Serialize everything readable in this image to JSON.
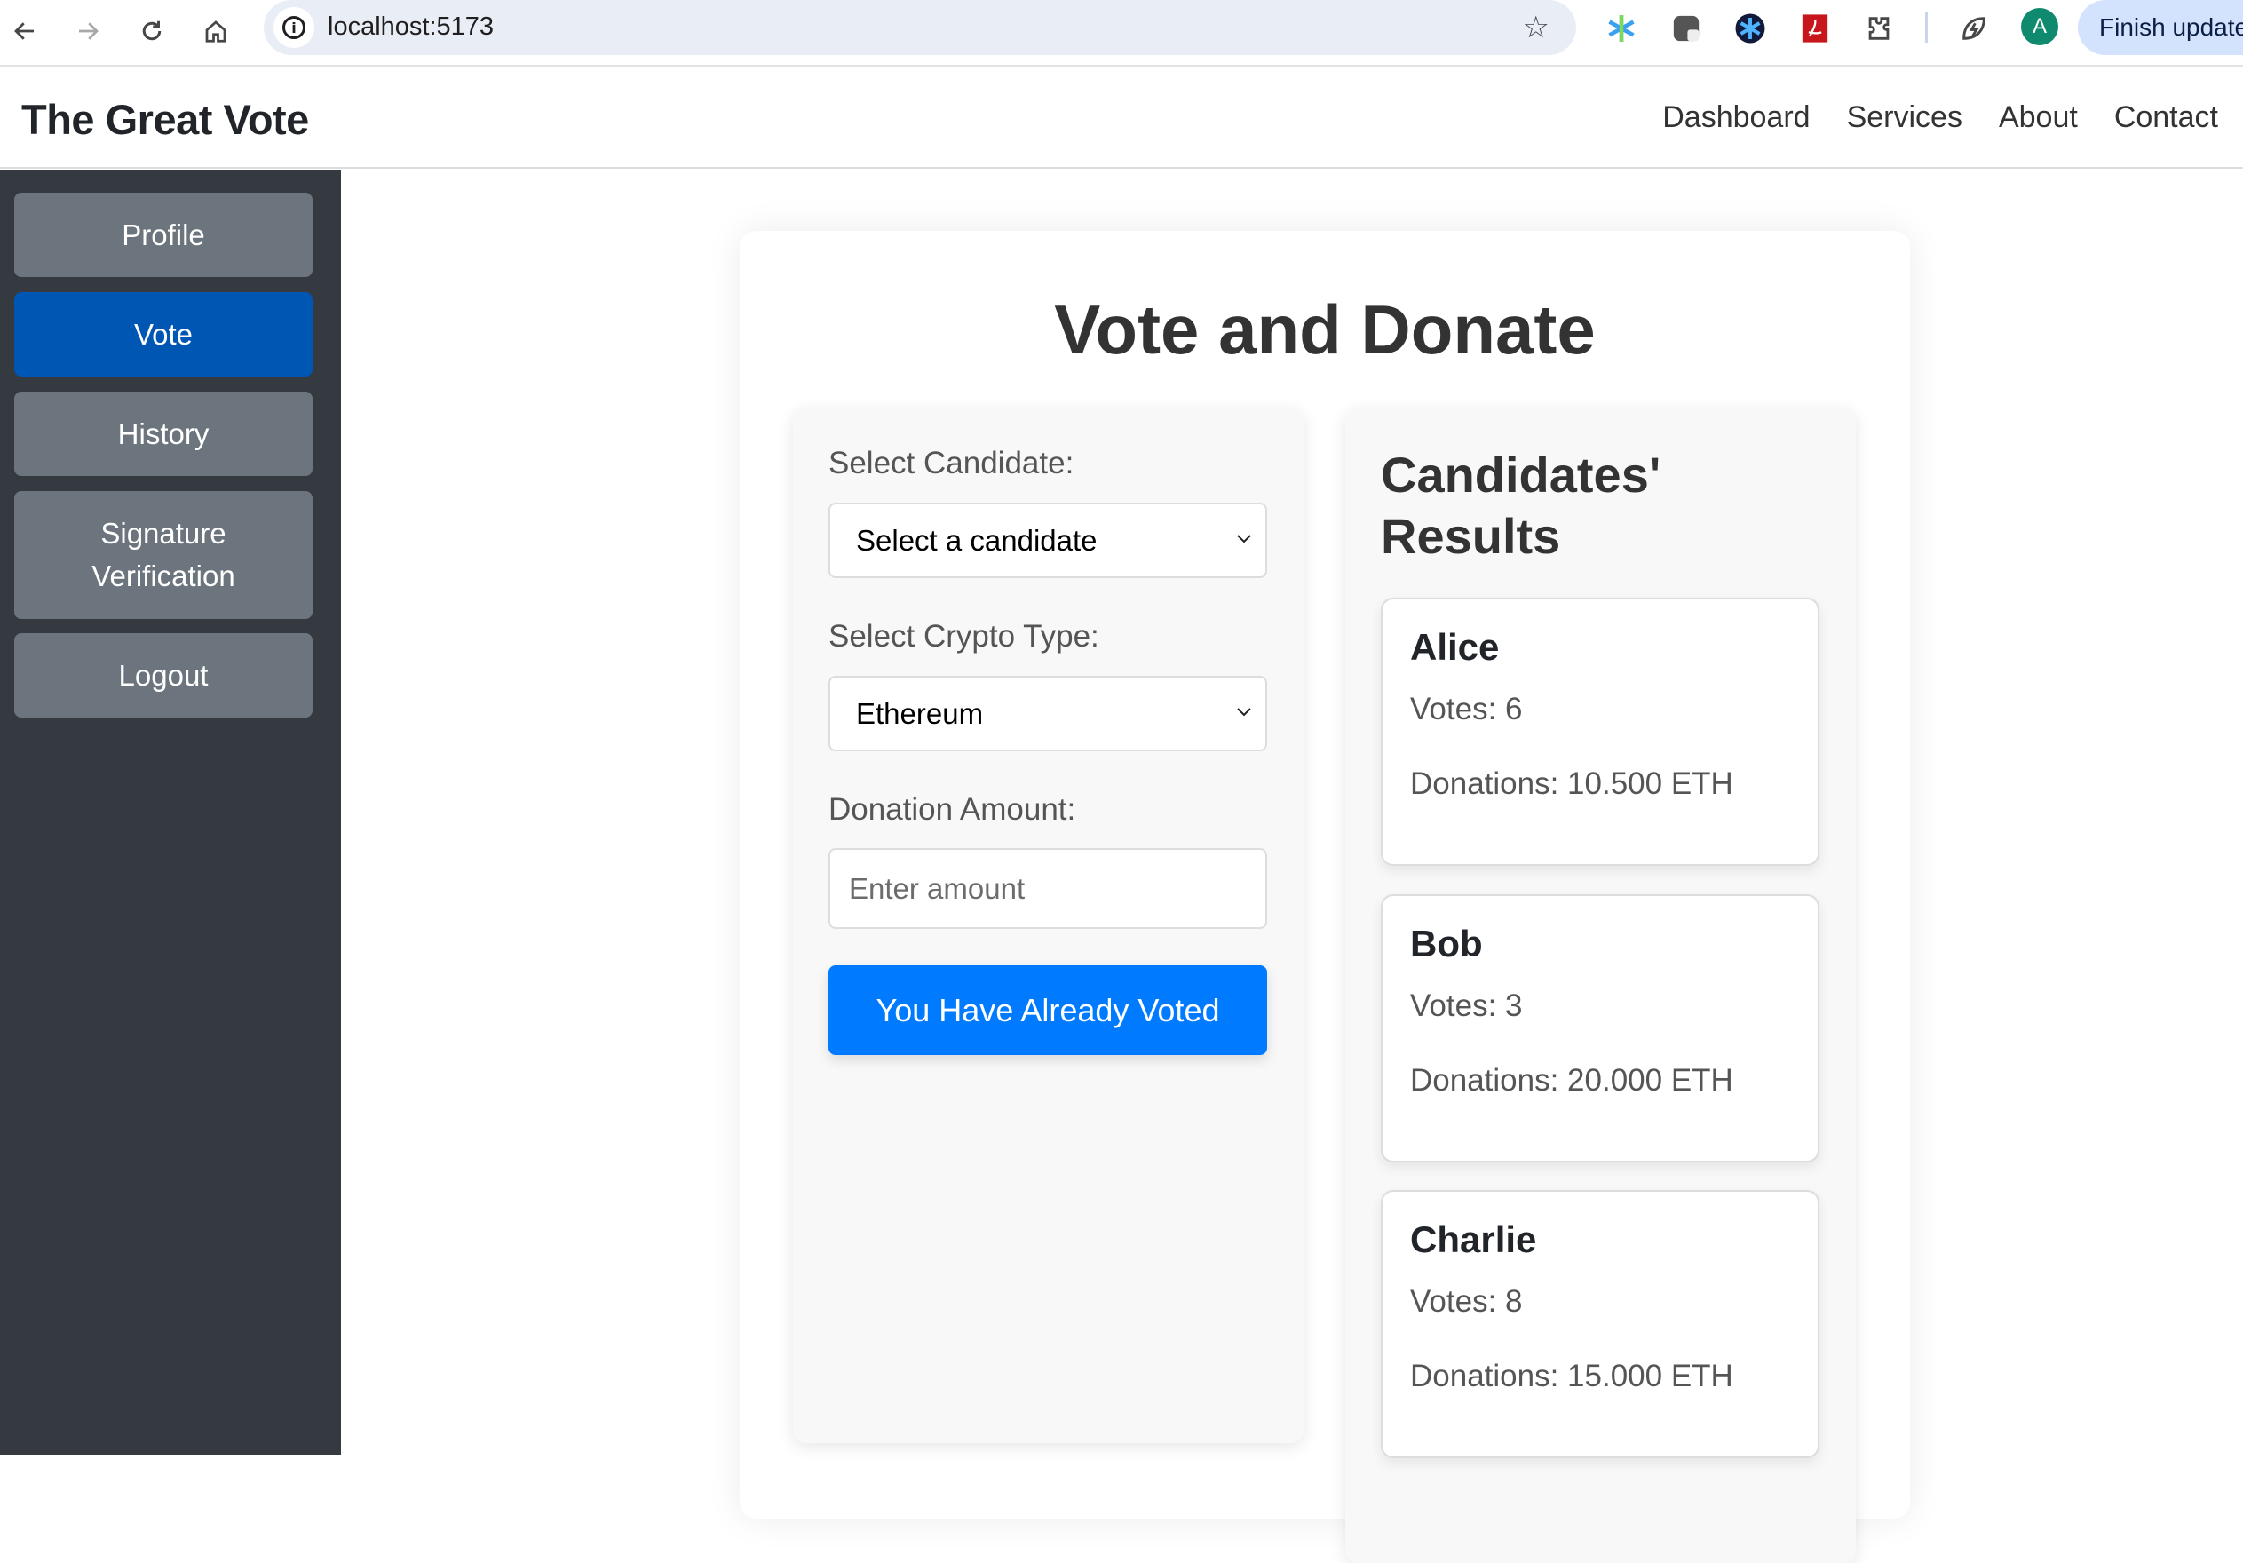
{
  "browser": {
    "url": "localhost:5173",
    "update_label": "Finish update",
    "profile_initial": "A",
    "extensions": [
      "perplexity-icon",
      "screencast-icon",
      "asterisk-extension-icon",
      "pdf-extension-icon",
      "extensions-puzzle-icon",
      "energy-saver-icon"
    ]
  },
  "header": {
    "brand": "The Great Vote",
    "nav": [
      "Dashboard",
      "Services",
      "About",
      "Contact"
    ]
  },
  "sidebar": {
    "items": [
      {
        "label": "Profile",
        "active": false
      },
      {
        "label": "Vote",
        "active": true
      },
      {
        "label": "History",
        "active": false
      },
      {
        "label": "Signature Verification",
        "active": false
      },
      {
        "label": "Logout",
        "active": false
      }
    ]
  },
  "main": {
    "title": "Vote and Donate",
    "form": {
      "candidate_label": "Select Candidate:",
      "candidate_value": "Select a candidate",
      "crypto_label": "Select Crypto Type:",
      "crypto_value": "Ethereum",
      "amount_label": "Donation Amount:",
      "amount_placeholder": "Enter amount",
      "amount_value": "",
      "submit_label": "You Have Already Voted"
    },
    "results": {
      "title": "Candidates' Results",
      "candidates": [
        {
          "name": "Alice",
          "votes": "Votes: 6",
          "donations": "Donations: 10.500 ETH"
        },
        {
          "name": "Bob",
          "votes": "Votes: 3",
          "donations": "Donations: 20.000 ETH"
        },
        {
          "name": "Charlie",
          "votes": "Votes: 8",
          "donations": "Donations: 15.000 ETH"
        }
      ]
    }
  },
  "colors": {
    "sidebar_bg": "#343a40",
    "sidebar_button": "#6c757d",
    "sidebar_active": "#0056b3",
    "primary_button": "#007bff"
  }
}
